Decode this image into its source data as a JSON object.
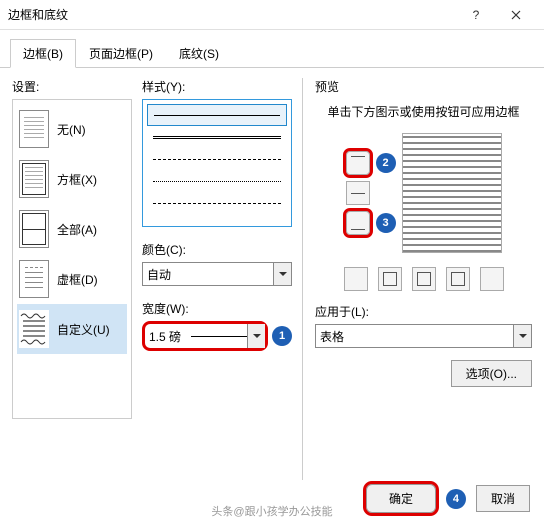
{
  "window": {
    "title": "边框和底纹"
  },
  "tabs": {
    "border": "边框(B)",
    "page_border": "页面边框(P)",
    "shading": "底纹(S)"
  },
  "col1": {
    "label": "设置:",
    "items": {
      "none": "无(N)",
      "box": "方框(X)",
      "all": "全部(A)",
      "dashed": "虚框(D)",
      "custom": "自定义(U)"
    }
  },
  "col2": {
    "style_label": "样式(Y):",
    "color_label": "颜色(C):",
    "color_value": "自动",
    "width_label": "宽度(W):",
    "width_value": "1.5 磅"
  },
  "preview": {
    "label": "预览",
    "hint": "单击下方图示或使用按钮可应用边框",
    "apply_label": "应用于(L):",
    "apply_value": "表格",
    "options": "选项(O)..."
  },
  "footer": {
    "ok": "确定",
    "cancel": "取消"
  },
  "badges": {
    "b1": "1",
    "b2": "2",
    "b3": "3",
    "b4": "4"
  },
  "watermark": "头条@跟小孩学办公技能"
}
